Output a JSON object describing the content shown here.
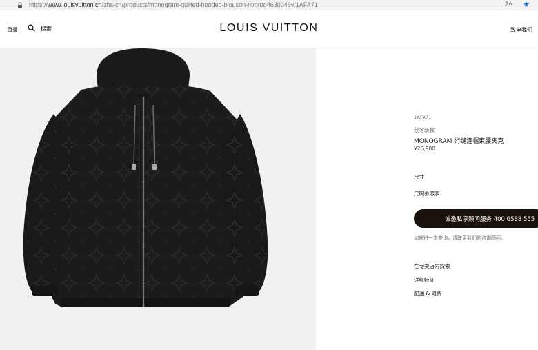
{
  "browser": {
    "url_prefix": "https://",
    "url_host": "www.louisvuitton.cn",
    "url_path": "/zhs-cn/products/monogram-quilted-hooded-blouson-nvprod4630046v/1AFA71",
    "read_aloud": "Aᴬ"
  },
  "header": {
    "menu_label": "目录",
    "search_label": "搜索",
    "brand": "LOUIS VUITTON",
    "contact_label": "致电我们"
  },
  "product": {
    "sku": "1AFA71",
    "season": "秋冬新款",
    "name": "MONOGRAM 绗缝连帽束腰夹克",
    "price": "¥26,900",
    "size_label": "尺寸",
    "size_guide": "尺码参照表",
    "cta_label": "诚邀私享顾问服务 400 6588 555",
    "help_text": "如需进一步查询，请联系我们的咨询顾问。",
    "links": {
      "store": "在专卖店内探索",
      "details": "详细特征",
      "delivery": "配送 & 退货"
    }
  },
  "colors": {
    "ink": "#19110b",
    "media_bg": "#f1f1f1",
    "jacket": "#1b1b1b"
  }
}
